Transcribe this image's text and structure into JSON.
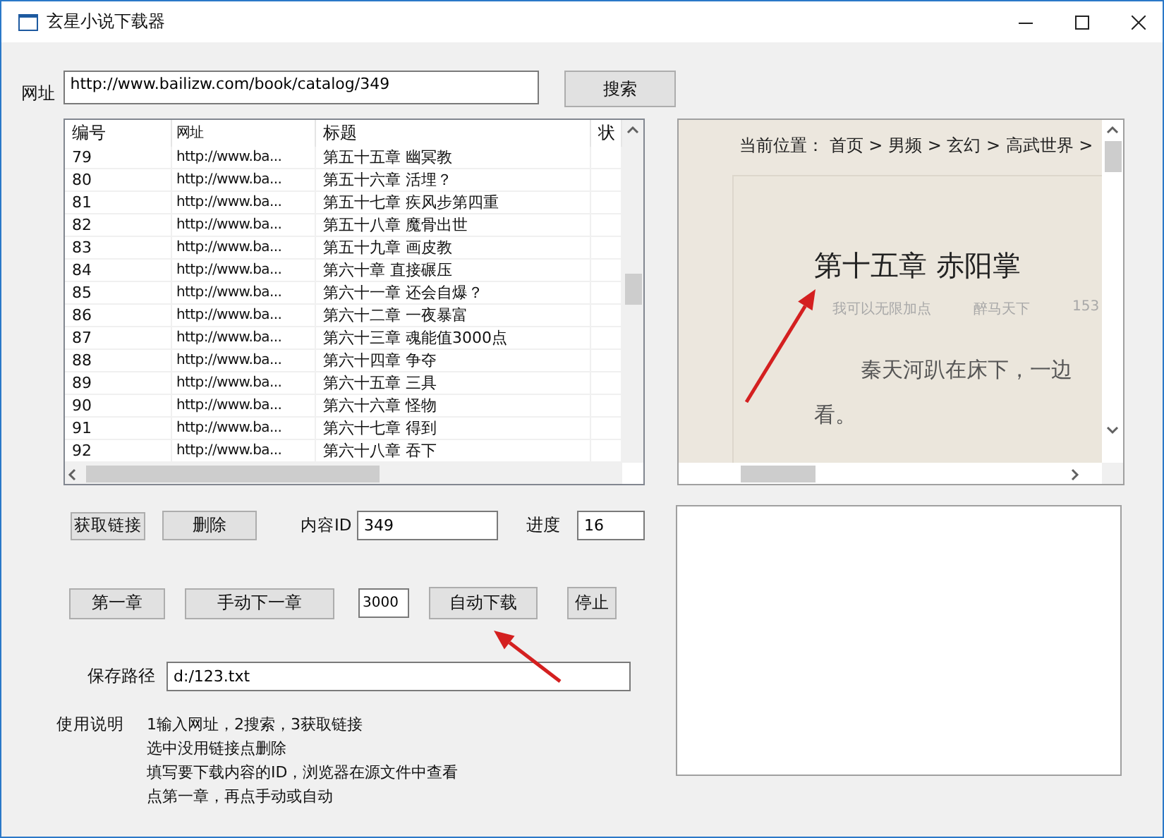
{
  "window": {
    "title": "玄星小说下载器"
  },
  "url": {
    "label": "网址",
    "value": "http://www.bailizw.com/book/catalog/349"
  },
  "search_button": "搜索",
  "table": {
    "columns": [
      "编号",
      "网址",
      "标题",
      "状"
    ],
    "rows": [
      {
        "cells": [
          "79",
          "http://www.ba...",
          "第五十五章 幽冥教"
        ]
      },
      {
        "cells": [
          "80",
          "http://www.ba...",
          "第五十六章 活埋？"
        ]
      },
      {
        "cells": [
          "81",
          "http://www.ba...",
          "第五十七章 疾风步第四重"
        ]
      },
      {
        "cells": [
          "82",
          "http://www.ba...",
          "第五十八章 魔骨出世"
        ]
      },
      {
        "cells": [
          "83",
          "http://www.ba...",
          "第五十九章 画皮教"
        ]
      },
      {
        "cells": [
          "84",
          "http://www.ba...",
          "第六十章 直接碾压"
        ]
      },
      {
        "cells": [
          "85",
          "http://www.ba...",
          "第六十一章 还会自爆？"
        ]
      },
      {
        "cells": [
          "86",
          "http://www.ba...",
          "第六十二章 一夜暴富"
        ]
      },
      {
        "cells": [
          "87",
          "http://www.ba...",
          "第六十三章 魂能值3000点"
        ]
      },
      {
        "cells": [
          "88",
          "http://www.ba...",
          "第六十四章 争夺"
        ]
      },
      {
        "cells": [
          "89",
          "http://www.ba...",
          "第六十五章 三具"
        ]
      },
      {
        "cells": [
          "90",
          "http://www.ba...",
          "第六十六章 怪物"
        ]
      },
      {
        "cells": [
          "91",
          "http://www.ba...",
          "第六十七章 得到"
        ]
      },
      {
        "cells": [
          "92",
          "http://www.ba...",
          "第六十八章 吞下"
        ]
      }
    ]
  },
  "browser": {
    "breadcrumb": "当前位置： 首页 > 男频 > 玄幻 > 高武世界 >",
    "chapter_title": "第十五章 赤阳掌",
    "meta": [
      "我可以无限加点",
      "醉马天下",
      "153"
    ],
    "paragraphs": [
      "秦天河趴在床下，一边",
      "看。"
    ]
  },
  "link_buttons": [
    "获取链接",
    "删除"
  ],
  "content_id": {
    "label": "内容ID",
    "value": "349"
  },
  "progress": {
    "label": "进度",
    "value": "16"
  },
  "first_chapter_button": "第一章",
  "manual_next_button": "手动下一章",
  "interval": {
    "value": "3000"
  },
  "auto_download_button": "自动下载",
  "stop_button": "停止",
  "save_path": {
    "label": "保存路径",
    "value": "d:/123.txt"
  },
  "instructions": {
    "label": "使用说明",
    "lines": [
      "1输入网址，2搜索，3获取链接",
      "选中没用链接点删除",
      "填写要下载内容的ID，浏览器在源文件中查看",
      "点第一章，再点手动或自动"
    ]
  }
}
